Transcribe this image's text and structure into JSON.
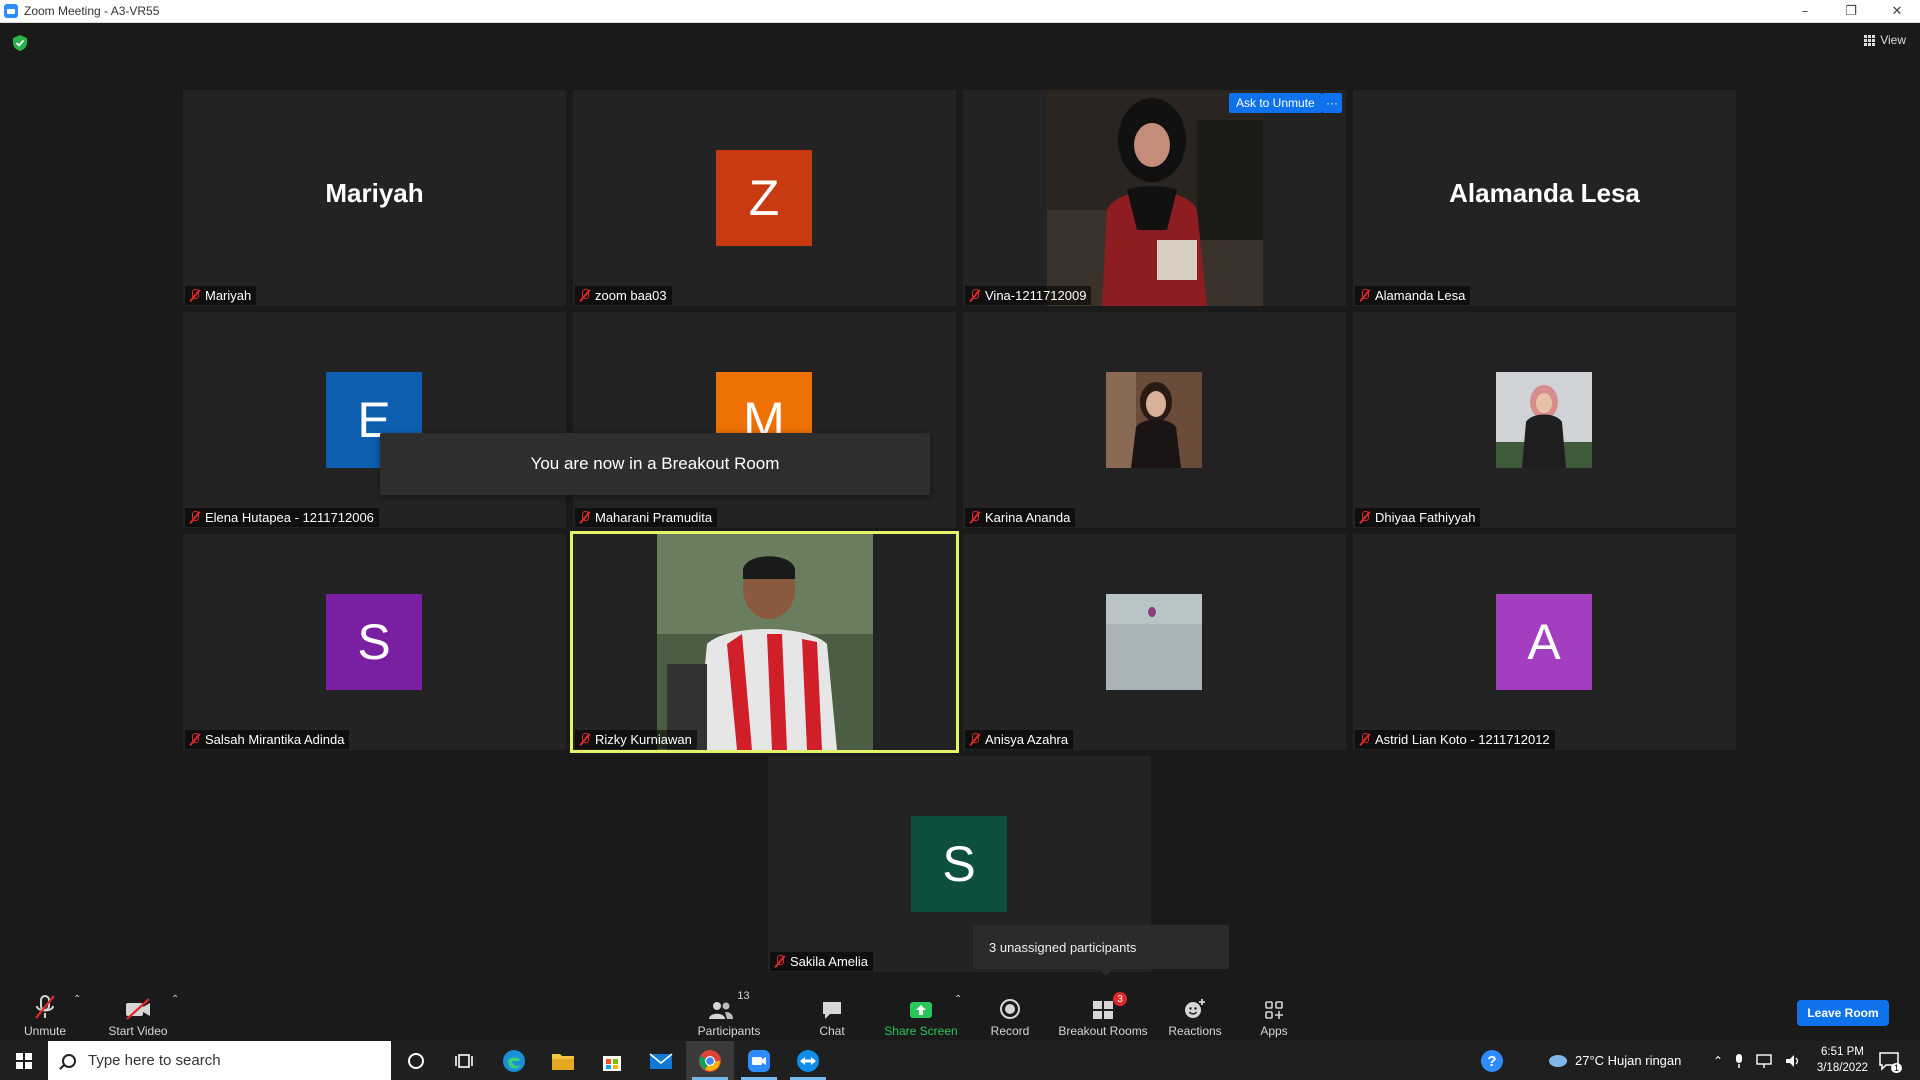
{
  "window": {
    "title": "Zoom Meeting - A3-VR55",
    "minimize": "–",
    "restore": "❐",
    "close": "✕"
  },
  "header": {
    "view_label": "View"
  },
  "tiles": [
    {
      "name": "Mariyah",
      "big_name": "Mariyah"
    },
    {
      "name": "zoom baa03",
      "initial": "Z",
      "color": "#c93a12"
    },
    {
      "name": "Vina-1211712009"
    },
    {
      "name": "Alamanda Lesa",
      "big_name": "Alamanda Lesa"
    },
    {
      "name": "Elena Hutapea - 1211712006",
      "initial": "E",
      "color": "#0e5fb0"
    },
    {
      "name": "Maharani Pramudita",
      "initial": "M",
      "color": "#ee7103"
    },
    {
      "name": "Karina Ananda"
    },
    {
      "name": "Dhiyaa Fathiyyah"
    },
    {
      "name": "Salsah Mirantika Adinda",
      "initial": "S",
      "color": "#7b1fa2"
    },
    {
      "name": "Rizky Kurniawan"
    },
    {
      "name": "Anisya Azahra"
    },
    {
      "name": "Astrid Lian Koto - 1211712012",
      "initial": "A",
      "color": "#a43ec1"
    },
    {
      "name": "Sakila Amelia",
      "initial": "S",
      "color": "#0b4f3c"
    }
  ],
  "overlay": {
    "breakout_toast": "You are now in a Breakout Room",
    "ask_to_unmute": "Ask to Unmute",
    "more": "···",
    "unassigned": "3 unassigned participants"
  },
  "toolbar": {
    "unmute": "Unmute",
    "start_video": "Start Video",
    "participants": "Participants",
    "participants_count": "13",
    "chat": "Chat",
    "share_screen": "Share Screen",
    "record": "Record",
    "breakout_rooms": "Breakout Rooms",
    "breakout_badge": "3",
    "reactions": "Reactions",
    "apps": "Apps",
    "leave_room": "Leave Room",
    "caret": "⌃"
  },
  "taskbar": {
    "search_placeholder": "Type here to search",
    "weather": "27°C  Hujan ringan",
    "time": "6:51 PM",
    "date": "3/18/2022",
    "notification_count": "1"
  },
  "colors": {
    "accent": "#0e72ed",
    "speaker_border": "#e7f26b",
    "share_green": "#27c75a",
    "muted_red": "#e02828"
  }
}
